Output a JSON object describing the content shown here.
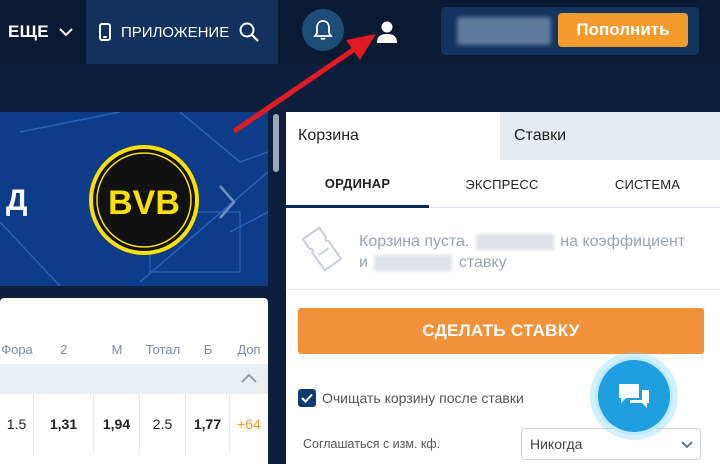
{
  "header": {
    "more_label": "ЕЩЕ",
    "app_label": "ПРИЛОЖЕНИЕ",
    "topup_label": "Пополнить"
  },
  "odds": {
    "headers": [
      "Фора",
      "2",
      "М",
      "Тотал",
      "Б",
      "Доп"
    ],
    "row": [
      "1.5",
      "1,31",
      "1,94",
      "2.5",
      "1,77",
      "+64"
    ]
  },
  "banner": {
    "partial_text": "Д",
    "logo_text": "BVB"
  },
  "betslip": {
    "tab_cart": "Корзина",
    "tab_bets": "Ставки",
    "type_single": "ОРДИНАР",
    "type_express": "ЭКСПРЕСС",
    "type_system": "СИСТЕМА",
    "empty_line1_start": "Корзина пуста.",
    "empty_line1_end": "на коэффициент",
    "empty_line2_start": "и",
    "empty_line2_end": "ставку",
    "place_bet_label": "СДЕЛАТЬ СТАВКУ",
    "clear_label": "Очищать корзину после ставки",
    "agree_label": "Соглашаться с изм. кф.",
    "agree_value": "Никогда"
  },
  "colors": {
    "accent_orange": "#f39c2d",
    "navy": "#0a1a33",
    "chat_blue": "#1e9fe0",
    "arrow_red": "#e21b23"
  }
}
